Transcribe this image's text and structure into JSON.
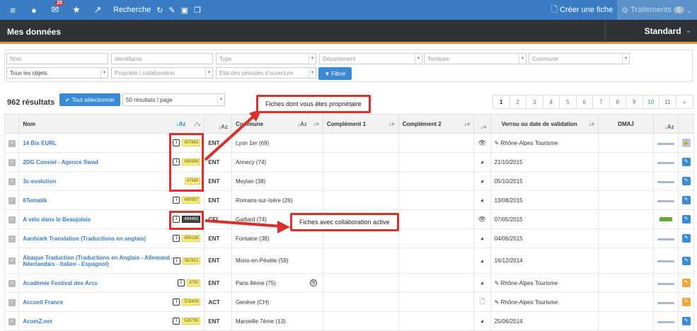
{
  "topbar": {
    "notif_count": "25",
    "search_label": "Recherche",
    "create_label": "Créer une fiche",
    "treatments_label": "Traitements",
    "treatments_count": "0"
  },
  "title": "Mes données",
  "view": "Standard",
  "filters": {
    "nom": "Nom",
    "identifiants": "Identifiants",
    "type": "Type",
    "departement": "Département",
    "territoire": "Territoire",
    "commune": "Commune",
    "objets": "Tous les objets",
    "propriete": "Propriété / collaboration",
    "periodes": "Etat des périodes d'ouverture",
    "filtrer": "Filtrer"
  },
  "results_label": "962 résultats",
  "select_all": "Tout sélectionner",
  "per_page": "50 résultats / page",
  "pages": [
    "1",
    "2",
    "3",
    "4",
    "5",
    "6",
    "7",
    "8",
    "9",
    "10",
    "11",
    "»"
  ],
  "columns": {
    "nom": "Nom",
    "commune": "Commune",
    "comp1": "Complément 1",
    "comp2": "Complément 2",
    "verrou": "Verrou ou date de validation",
    "dmaj": "DMAJ"
  },
  "rows": [
    {
      "name": "14 Bis EURL",
      "id": "407463",
      "type": "ENT",
      "commune": "Lyon 1er (69)",
      "status": "eye",
      "verrou": "✎ Rhône-Alpes Tourisme",
      "edit": "locked"
    },
    {
      "name": "2DG Consiel - Agence Swad",
      "id": "490958",
      "type": "ENT",
      "commune": "Annecy (74)",
      "status": "globe",
      "verrou": "21/10/2015",
      "edit": "blue"
    },
    {
      "name": "3c-evolution",
      "id": "47540",
      "type": "ENT",
      "commune": "Meylan (38)",
      "status": "globe",
      "verrou": "05/10/2015",
      "edit": "blue"
    },
    {
      "name": "6Tematik",
      "id": "490957",
      "type": "ENT",
      "commune": "Romans-sur-Isère (26)",
      "status": "globe",
      "verrou": "13/08/2015",
      "edit": "blue"
    },
    {
      "name": "A vélo dans le Beaujolais",
      "id": "494462",
      "type": "CEL",
      "commune": "Gaillard (74)",
      "status": "eye",
      "verrou": "07/05/2015",
      "edit": "blue"
    },
    {
      "name": "Aardvark Translation (Traductions en anglais)",
      "id": "658126",
      "type": "ENT",
      "commune": "Fontaine (38)",
      "status": "globe",
      "verrou": "04/06/2015",
      "edit": "blue"
    },
    {
      "name": "Abaque Traduction (Traductions en Anglais - Allemand - Néerlandais - Italien - Espagnol)",
      "id": "587811",
      "type": "ENT",
      "commune": "Mons-en-Pévèle (59)",
      "status": "globe",
      "verrou": "16/12/2014",
      "edit": "blue"
    },
    {
      "name": "Académie Festival des Arcs",
      "id": "4792",
      "type": "ENT",
      "commune": "Paris 8ème (75)",
      "status": "globe",
      "verrou": "✎ Rhône-Alpes Tourisme",
      "edit": "orange"
    },
    {
      "name": "Accueil France",
      "id": "578409",
      "type": "ACT",
      "commune": "Genève (CH)",
      "status": "doc",
      "verrou": "✎ Rhône-Alpes Tourisme",
      "edit": "orange"
    },
    {
      "name": "AcomZ.net",
      "id": "538795",
      "type": "ENT",
      "commune": "Marseille 7ème (13)",
      "status": "globe",
      "verrou": "25/06/2014",
      "edit": "blue"
    }
  ],
  "callouts": {
    "owner": "Fiches dont vous êtes propriétaire",
    "collab": "Fiches avec collaboration active"
  },
  "colors": {
    "accent": "#3b7dc4",
    "highlight": "#d9302c",
    "id_yellow": "#f8ec7a"
  }
}
